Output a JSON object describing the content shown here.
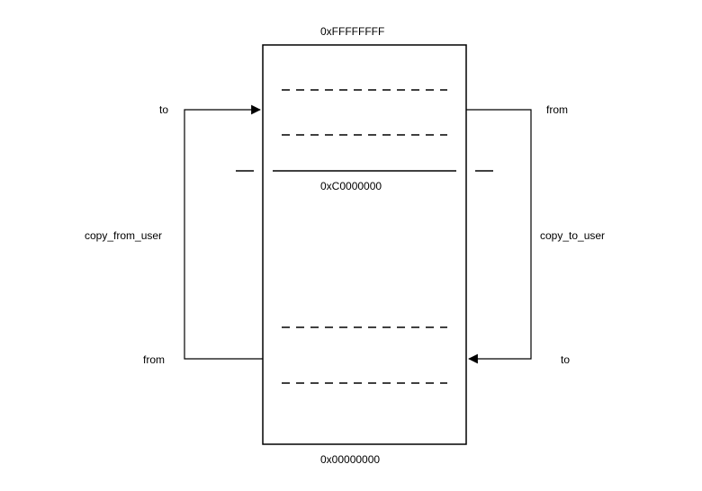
{
  "mem": {
    "top_addr": "0xFFFFFFFF",
    "split_addr": "0xC0000000",
    "bottom_addr": "0x00000000"
  },
  "left": {
    "top_endpoint": "to",
    "bottom_endpoint": "from",
    "func": "copy_from_user"
  },
  "right": {
    "top_endpoint": "from",
    "bottom_endpoint": "to",
    "func": "copy_to_user"
  }
}
